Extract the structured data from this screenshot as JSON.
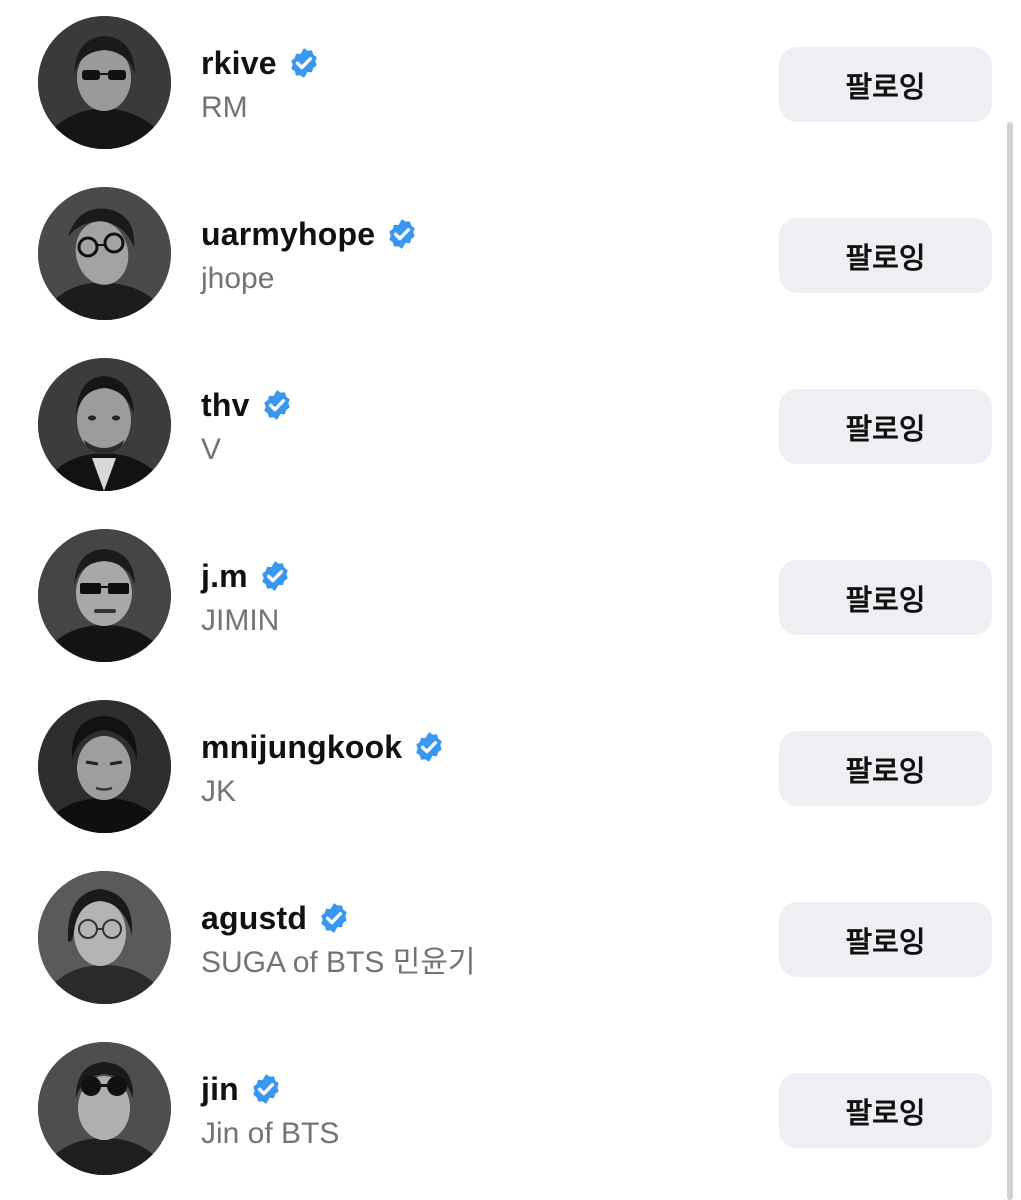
{
  "follow_list": {
    "accent_color": "#3897f0",
    "items": [
      {
        "username": "rkive",
        "name": "RM",
        "button": "팔로잉",
        "verified": true
      },
      {
        "username": "uarmyhope",
        "name": "jhope",
        "button": "팔로잉",
        "verified": true
      },
      {
        "username": "thv",
        "name": "V",
        "button": "팔로잉",
        "verified": true
      },
      {
        "username": "j.m",
        "name": "JIMIN",
        "button": "팔로잉",
        "verified": true
      },
      {
        "username": "mnijungkook",
        "name": "JK",
        "button": "팔로잉",
        "verified": true
      },
      {
        "username": "agustd",
        "name": "SUGA of BTS 민윤기",
        "button": "팔로잉",
        "verified": true
      },
      {
        "username": "jin",
        "name": "Jin of BTS",
        "button": "팔로잉",
        "verified": true
      }
    ]
  }
}
